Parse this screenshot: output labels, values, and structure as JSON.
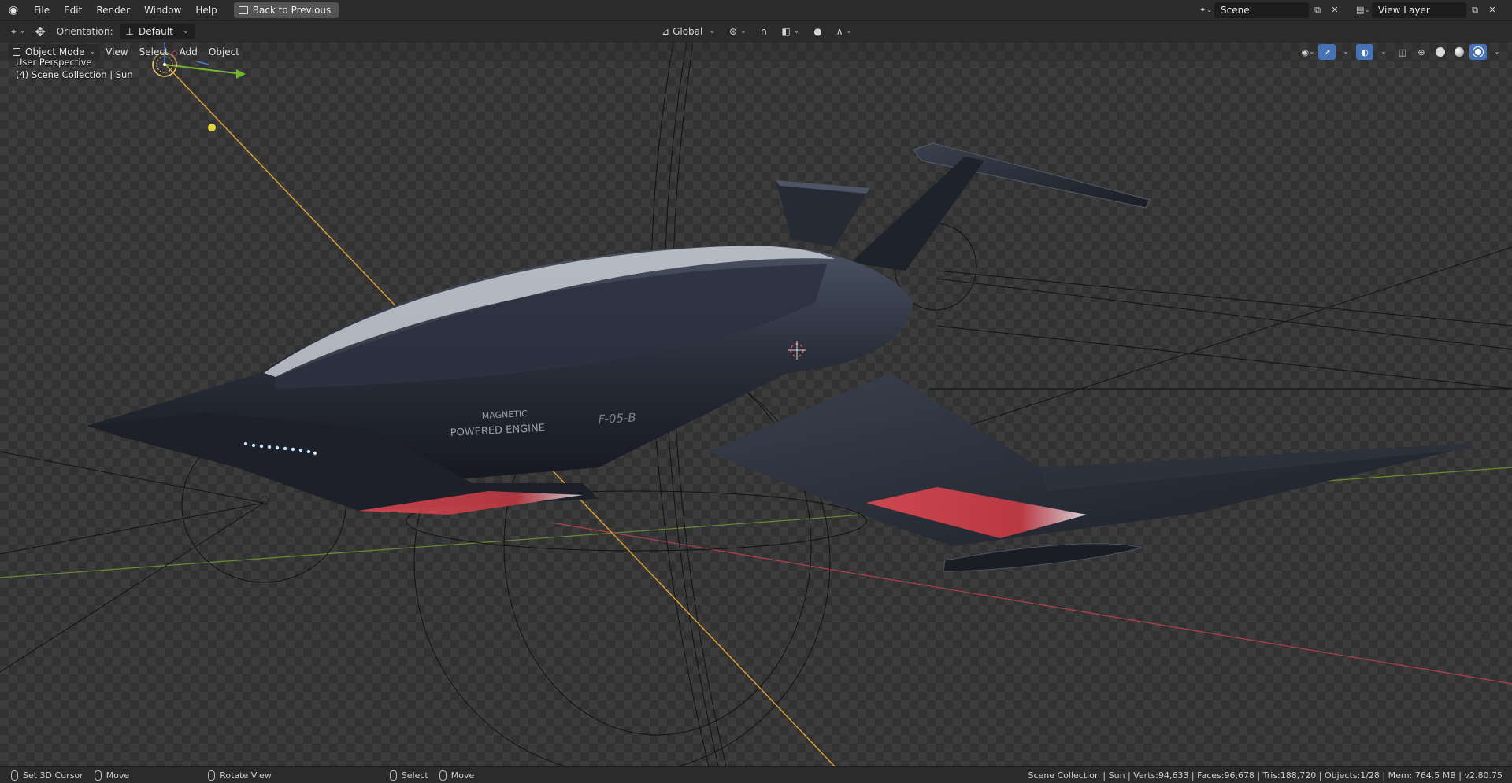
{
  "topbar": {
    "logo_icon": "blender-logo-icon",
    "menus": [
      "File",
      "Edit",
      "Render",
      "Window",
      "Help"
    ],
    "back_button": "Back to Previous",
    "scene_name": "Scene",
    "view_layer_name": "View Layer"
  },
  "toolheader": {
    "orientation_label": "Orientation:",
    "orientation_value": "Default",
    "transform_space": "Global"
  },
  "viewport": {
    "mode": "Object Mode",
    "menus": [
      "View",
      "Select",
      "Add",
      "Object"
    ],
    "perspective": "User Perspective",
    "collection_info": "(4) Scene Collection | Sun",
    "decal_text_1": "MAGNETIC",
    "decal_text_2": "POWERED ENGINE",
    "decal_text_3": "F-05-B"
  },
  "statusbar": {
    "hints": [
      "Set 3D Cursor",
      "Move",
      "Rotate View",
      "Select",
      "Move"
    ],
    "stats": "Scene Collection | Sun | Verts:94,633 | Faces:96,678 | Tris:188,720 | Objects:1/28 | Mem: 764.5 MB | v2.80.75"
  },
  "colors": {
    "accent_blue": "#4772b3",
    "x_axis": "#c94a55",
    "y_axis": "#7fb53a",
    "sun_line": "#e0a232",
    "ship_body": "#2a2f3b",
    "ship_red": "#d9434a"
  }
}
